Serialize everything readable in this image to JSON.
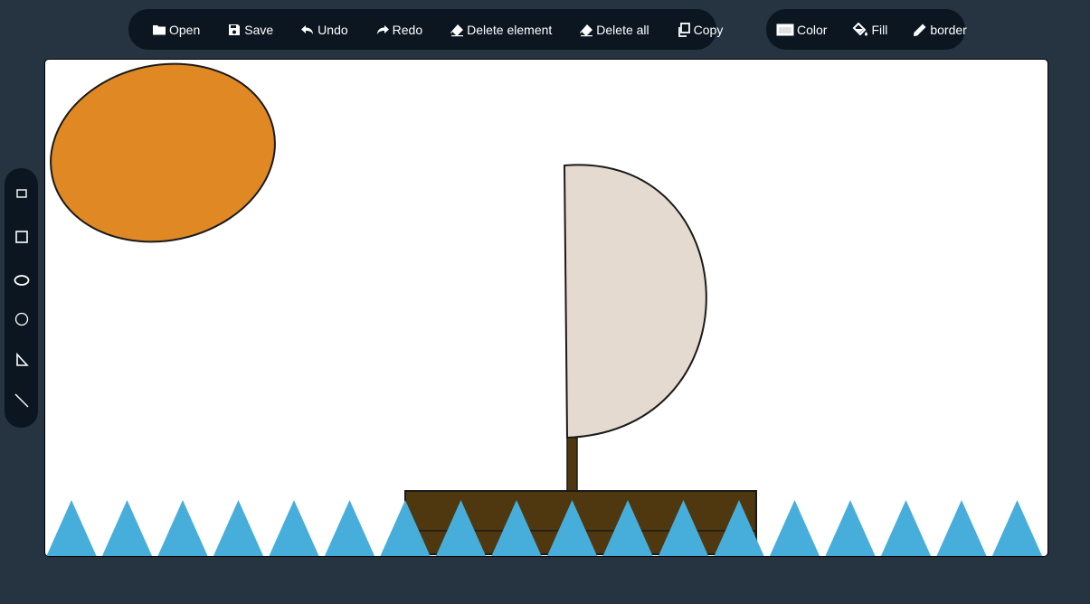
{
  "toolbar": {
    "open": "Open",
    "save": "Save",
    "undo": "Undo",
    "redo": "Redo",
    "delete_element": "Delete element",
    "delete_all": "Delete all",
    "copy": "Copy"
  },
  "style_toolbar": {
    "color": "Color",
    "fill": "Fill",
    "border": "border"
  },
  "sidebar": {
    "tools": [
      "rectangle-tool",
      "square-tool",
      "ellipse-tool",
      "circle-tool",
      "triangle-tool",
      "line-tool"
    ]
  },
  "colors": {
    "background": "#263442",
    "toolbar": "#0b1620",
    "sun": "#e08824",
    "sail": "#e5dad0",
    "boat": "#4f380f",
    "waves": "#47aedc",
    "stroke": "#1a1a1a"
  },
  "canvas": {
    "shapes": [
      {
        "name": "sun-ellipse",
        "type": "ellipse"
      },
      {
        "name": "sail-shape",
        "type": "semicircle"
      },
      {
        "name": "mast",
        "type": "rectangle"
      },
      {
        "name": "boat-hull",
        "type": "rectangle"
      },
      {
        "name": "waves",
        "type": "triangle-row",
        "count": 18
      }
    ]
  }
}
